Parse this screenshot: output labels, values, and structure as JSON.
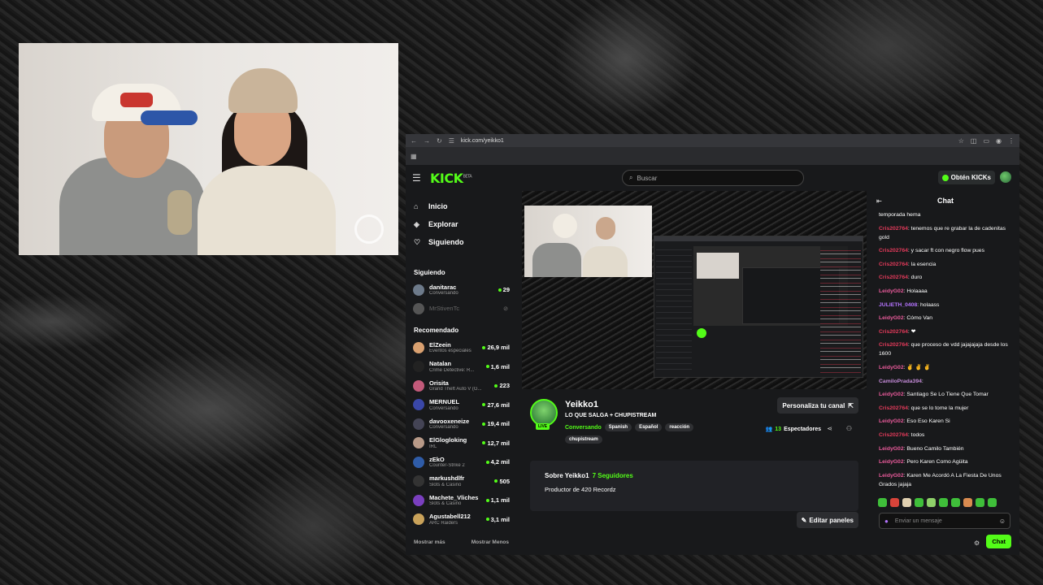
{
  "browser": {
    "url": "kick.com/yeikko1",
    "bookmark_icon": "grid-icon"
  },
  "kick": {
    "logo": "KICK",
    "logo_sup": "BETA",
    "search_placeholder": "Buscar",
    "obten_label": "Obtén KICKs"
  },
  "sidebar": {
    "nav": [
      {
        "label": "Inicio",
        "icon": "home-icon"
      },
      {
        "label": "Explorar",
        "icon": "compass-icon"
      },
      {
        "label": "Siguiendo",
        "icon": "heart-icon"
      }
    ],
    "following_title": "Siguiendo",
    "following": [
      {
        "name": "danitarac",
        "category": "Conversando",
        "count": "29",
        "color": "#6d7a8a",
        "online": true
      },
      {
        "name": "MrStivenTc",
        "category": "",
        "count": "",
        "color": "#555",
        "online": false
      }
    ],
    "recommended_title": "Recomendado",
    "recommended": [
      {
        "name": "ElZeein",
        "category": "Eventos especiales",
        "count": "26,9 mil",
        "color": "#d9a070"
      },
      {
        "name": "Natalan",
        "category": "Crime Detective: R...",
        "count": "1,6 mil",
        "color": "#222"
      },
      {
        "name": "Orisita",
        "category": "Grand Theft Auto V (G...",
        "count": "223",
        "color": "#c25a7a"
      },
      {
        "name": "MERNUEL",
        "category": "Conversando",
        "count": "27,6 mil",
        "color": "#3a47a8"
      },
      {
        "name": "davooxeneize",
        "category": "Conversando",
        "count": "19,4 mil",
        "color": "#445"
      },
      {
        "name": "ElGlogloking",
        "category": "IRL",
        "count": "12,7 mil",
        "color": "#b89a88"
      },
      {
        "name": "zEkO",
        "category": "Counter-Strike 2",
        "count": "4,2 mil",
        "color": "#2f5ca8"
      },
      {
        "name": "markushdlfr",
        "category": "Slots & Casino",
        "count": "505",
        "color": "#333"
      },
      {
        "name": "Machete_Vliches",
        "category": "Slots & Casino",
        "count": "1,1 mil",
        "color": "#7a3fbf"
      },
      {
        "name": "Agustabell212",
        "category": "ARC Raiders",
        "count": "3,1 mil",
        "color": "#c9a25a"
      }
    ],
    "show_more": "Mostrar más",
    "show_less": "Mostrar Menos"
  },
  "stream": {
    "streamer": "Yeikko1",
    "live_badge": "LIVE",
    "title": "LO QUE SALGA + CHUPISTREAM",
    "category": "Conversando",
    "tags": [
      "Spanish",
      "Español",
      "reacción"
    ],
    "tags2": [
      "chupistream"
    ],
    "personaliza": "Personaliza tu canal",
    "viewers_count": "13",
    "viewers_label": "Espectadores",
    "about_title": "Sobre Yeikko1",
    "followers": "7 Seguidores",
    "description": "Productor de 420 Recordz",
    "edit_panels": "Editar paneles"
  },
  "chat": {
    "title": "Chat",
    "messages": [
      {
        "user": "",
        "text": "temporada hema",
        "color": "#ffffff"
      },
      {
        "user": "Cris202764",
        "text": ": tenemos que re grabar la de cadenitas gold",
        "color": "#e23a5a"
      },
      {
        "user": "Cris202764",
        "text": ": y sacar ft con negro flow pues",
        "color": "#e23a5a"
      },
      {
        "user": "Cris202764",
        "text": ": la esencia",
        "color": "#e23a5a"
      },
      {
        "user": "Cris202764",
        "text": ": duro",
        "color": "#e23a5a"
      },
      {
        "user": "LeidyG02",
        "text": ": Holaaaa",
        "color": "#e85a9a"
      },
      {
        "user": "JULIETH_0408",
        "text": ": holaass",
        "color": "#b574ff"
      },
      {
        "user": "LeidyG02",
        "text": ": Cómo Van",
        "color": "#e85a9a"
      },
      {
        "user": "Cris202764",
        "text": ": ❤",
        "color": "#e23a5a"
      },
      {
        "user": "Cris202764",
        "text": ": que proceso de vdd jajajajaja desde los 1600",
        "color": "#e23a5a"
      },
      {
        "user": "LeidyG02",
        "text": ": ✌ ✌ ✌",
        "color": "#e85a9a"
      },
      {
        "user": "CamiloPrada394",
        "text": ":",
        "color": "#c48bd8"
      },
      {
        "user": "LeidyG02",
        "text": ": Santiago Se Lo Tiene Que Tomar",
        "color": "#e85a9a"
      },
      {
        "user": "Cris202764",
        "text": ": que se lo tome la mujer",
        "color": "#e23a5a"
      },
      {
        "user": "LeidyG02",
        "text": ": Eso Eso Karen Si",
        "color": "#e85a9a"
      },
      {
        "user": "Cris202764",
        "text": ": todos",
        "color": "#e23a5a"
      },
      {
        "user": "LeidyG02",
        "text": ": Bueno Camilo También",
        "color": "#e85a9a"
      },
      {
        "user": "LeidyG02",
        "text": ": Pero Karen Como Agüita",
        "color": "#e85a9a"
      },
      {
        "user": "LeidyG02",
        "text": ": Karen Me Acordó A La Fiesta De Unos Grados jajaja",
        "color": "#e85a9a"
      }
    ],
    "input_placeholder": "Enviar un mensaje",
    "send_label": "Chat"
  },
  "colors": {
    "accent": "#53fc18",
    "bg": "#18191b"
  }
}
